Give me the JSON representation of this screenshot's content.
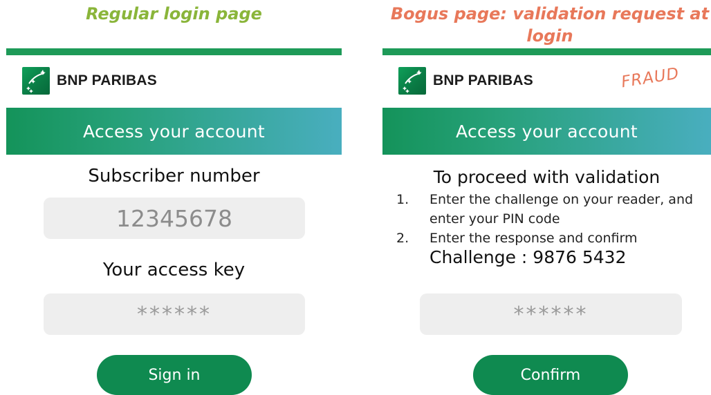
{
  "captions": {
    "regular": "Regular login page",
    "bogus": "Bogus page: validation request at login"
  },
  "regular_page": {
    "brand": "BNP PARIBAS",
    "banner": "Access your account",
    "subscriber_label": "Subscriber number",
    "subscriber_value": "12345678",
    "access_key_label": "Your access key",
    "access_key_value": "******",
    "button": "Sign in"
  },
  "bogus_page": {
    "brand": "BNP PARIBAS",
    "fraud_stamp": "FRAUD",
    "banner": "Access your account",
    "heading": "To proceed with validation",
    "steps": [
      {
        "num": "1.",
        "text": "Enter the challenge on your reader, and enter your PIN code"
      },
      {
        "num": "2.",
        "text": "Enter the response and confirm"
      }
    ],
    "challenge": "Challenge : 9876 5432",
    "response_value": "******",
    "button": "Confirm"
  },
  "colors": {
    "brand_green": "#0f8a50",
    "regular_caption": "#8ab53a",
    "bogus_caption": "#e8785a",
    "banner_start": "#14935a",
    "banner_end": "#49aebf"
  },
  "icons": {
    "logo": "bnp-paribas-stars-logo"
  }
}
